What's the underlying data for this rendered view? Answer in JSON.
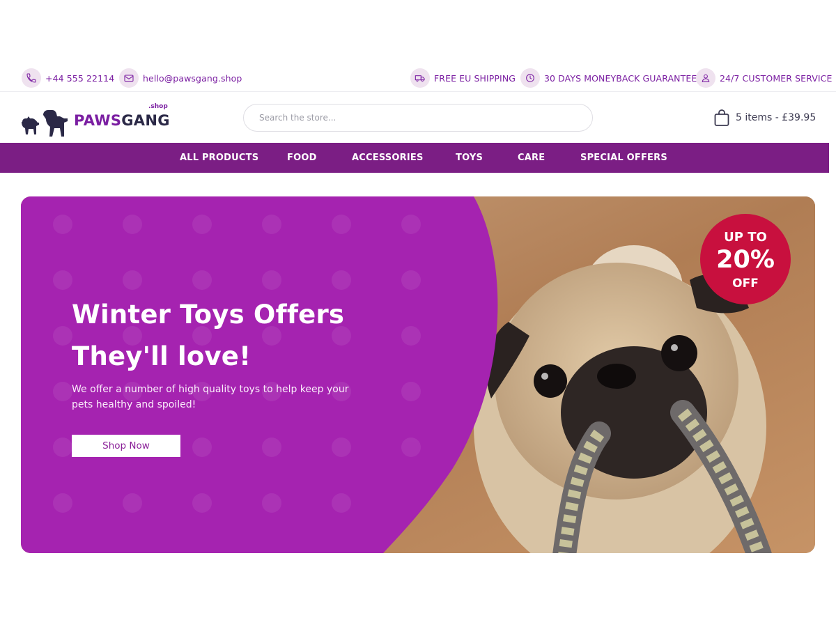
{
  "topbar": {
    "phone": "+44 555 22114",
    "email": "hello@pawsgang.shop",
    "shipping": "FREE EU SHIPPING",
    "guarantee": "30 DAYS MONEYBACK GUARANTEE",
    "service": "24/7 CUSTOMER SERVICE"
  },
  "header": {
    "logo_paws": "PAWS",
    "logo_gang": "GANG",
    "logo_sub": ".shop",
    "search_placeholder": "Search the store...",
    "cart_text": "5 items - £39.95"
  },
  "nav": {
    "items": [
      "ALL PRODUCTS",
      "FOOD",
      "ACCESSORIES",
      "TOYS",
      "CARE",
      "SPECIAL OFFERS"
    ]
  },
  "hero": {
    "title_line1": "Winter Toys Offers",
    "title_line2": "They'll love!",
    "description": "We offer a number of high quality toys to help keep your pets healthy and spoiled!",
    "button": "Shop Now",
    "badge_top": "UP TO",
    "badge_mid": "20%",
    "badge_bot": "OFF"
  },
  "colors": {
    "brand_purple": "#7b1e84",
    "hero_purple": "#a523b0",
    "badge_red": "#c8103e",
    "icon_bg": "#efe2ef"
  },
  "icons": {
    "phone": "phone-icon",
    "email": "envelope-icon",
    "shipping": "truck-icon",
    "guarantee": "clock-icon",
    "service": "person-icon",
    "cart": "shopping-bag-icon"
  }
}
